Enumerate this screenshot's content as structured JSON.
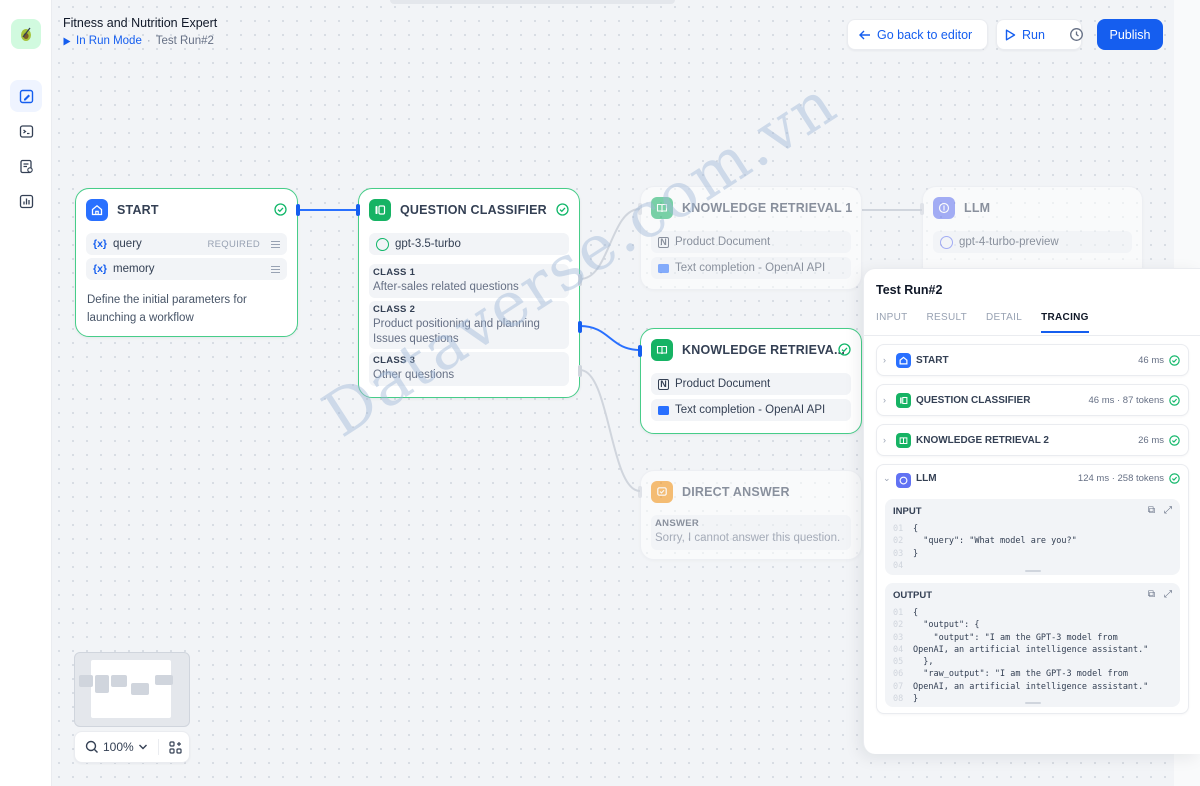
{
  "app": {
    "title": "Fitness and Nutrition Expert",
    "mode_label": "In Run Mode",
    "separator": "·",
    "run_name": "Test Run#2"
  },
  "toolbar": {
    "back_label": "Go back to editor",
    "run_label": "Run",
    "publish_label": "Publish"
  },
  "sidebar": {
    "items": [
      {
        "icon": "workflow-edit-icon",
        "active": true
      },
      {
        "icon": "terminal-icon",
        "active": false
      },
      {
        "icon": "logs-icon",
        "active": false
      },
      {
        "icon": "bar-chart-icon",
        "active": false
      }
    ]
  },
  "nodes": {
    "start": {
      "title": "START",
      "variables": [
        {
          "name": "query",
          "badge": "REQUIRED"
        },
        {
          "name": "memory",
          "badge": ""
        }
      ],
      "var_symbol": "{x}",
      "description": "Define the initial parameters for launching a workflow"
    },
    "classifier": {
      "title": "QUESTION CLASSIFIER",
      "model": "gpt-3.5-turbo",
      "classes": [
        {
          "label": "CLASS 1",
          "text": "After-sales related questions"
        },
        {
          "label": "CLASS 2",
          "text": "Product positioning and planning Issues questions"
        },
        {
          "label": "CLASS 3",
          "text": "Other questions"
        }
      ]
    },
    "kr1": {
      "title": "KNOWLEDGE RETRIEVAL 1",
      "items": [
        "Product Document",
        "Text completion - OpenAI API"
      ]
    },
    "kr2": {
      "title": "KNOWLEDGE RETRIEVA...",
      "items": [
        "Product Document",
        "Text completion - OpenAI API"
      ]
    },
    "llm": {
      "title": "LLM",
      "model": "gpt-4-turbo-preview"
    },
    "direct": {
      "title": "DIRECT ANSWER",
      "label": "ANSWER",
      "text": "Sorry, I cannot answer this question."
    }
  },
  "panel": {
    "title": "Test Run#2",
    "tabs": [
      "INPUT",
      "RESULT",
      "DETAIL",
      "TRACING"
    ],
    "active_tab": "TRACING",
    "traces": [
      {
        "name": "START",
        "meta": "46 ms",
        "color": "#2970ff"
      },
      {
        "name": "QUESTION CLASSIFIER",
        "meta": "46 ms · 87 tokens",
        "color": "#16b364"
      },
      {
        "name": "KNOWLEDGE RETRIEVAL 2",
        "meta": "26 ms",
        "color": "#16b364"
      },
      {
        "name": "LLM",
        "meta": "124 ms · 258 tokens",
        "color": "#6172f3"
      }
    ],
    "input_label": "INPUT",
    "output_label": "OUTPUT",
    "input_lines": [
      "{",
      "  \"query\": \"What model are you?\"",
      "}",
      ""
    ],
    "output_lines": [
      "{",
      "  \"output\": {",
      "    \"output\": \"I am the GPT-3 model from",
      "OpenAI, an artificial intelligence assistant.\"",
      "  },",
      "  \"raw_output\": \"I am the GPT-3 model from",
      "OpenAI, an artificial intelligence assistant.\"",
      "}"
    ],
    "input_line_numbers": [
      "01",
      "02",
      "03",
      "04"
    ],
    "output_line_numbers": [
      "01",
      "02",
      "03",
      "04",
      "05",
      "06",
      "07",
      "08"
    ]
  },
  "zoom": {
    "value": "100%"
  },
  "watermark": "Dataverse.com.vn",
  "colors": {
    "accent": "#155eef",
    "success": "#12b76a",
    "selected_border": "#47cd89"
  }
}
